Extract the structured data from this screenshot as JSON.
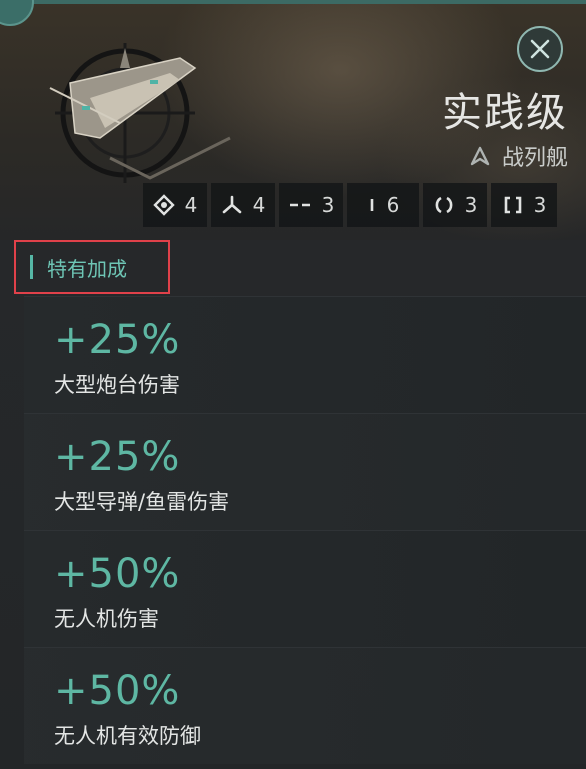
{
  "header": {
    "ship_name": "实践级",
    "ship_class": "战列舰",
    "close_icon": "close-icon",
    "class_icon": "chevron-up-icon"
  },
  "slots": [
    {
      "icon": "heavy-turret-icon",
      "count": "4"
    },
    {
      "icon": "tri-blade-icon",
      "count": "4"
    },
    {
      "icon": "double-dash-icon",
      "count": "3"
    },
    {
      "icon": "single-bar-icon",
      "count": "6"
    },
    {
      "icon": "ring-icon",
      "count": "3"
    },
    {
      "icon": "bracket-icon",
      "count": "3"
    }
  ],
  "bonus_section": {
    "title": "特有加成"
  },
  "bonuses": [
    {
      "value": "+25%",
      "label": "大型炮台伤害"
    },
    {
      "value": "+25%",
      "label": "大型导弹/鱼雷伤害"
    },
    {
      "value": "+50%",
      "label": "无人机伤害"
    },
    {
      "value": "+50%",
      "label": "无人机有效防御"
    }
  ],
  "colors": {
    "accent": "#5eb7a3",
    "highlight_border": "#e0414a"
  }
}
